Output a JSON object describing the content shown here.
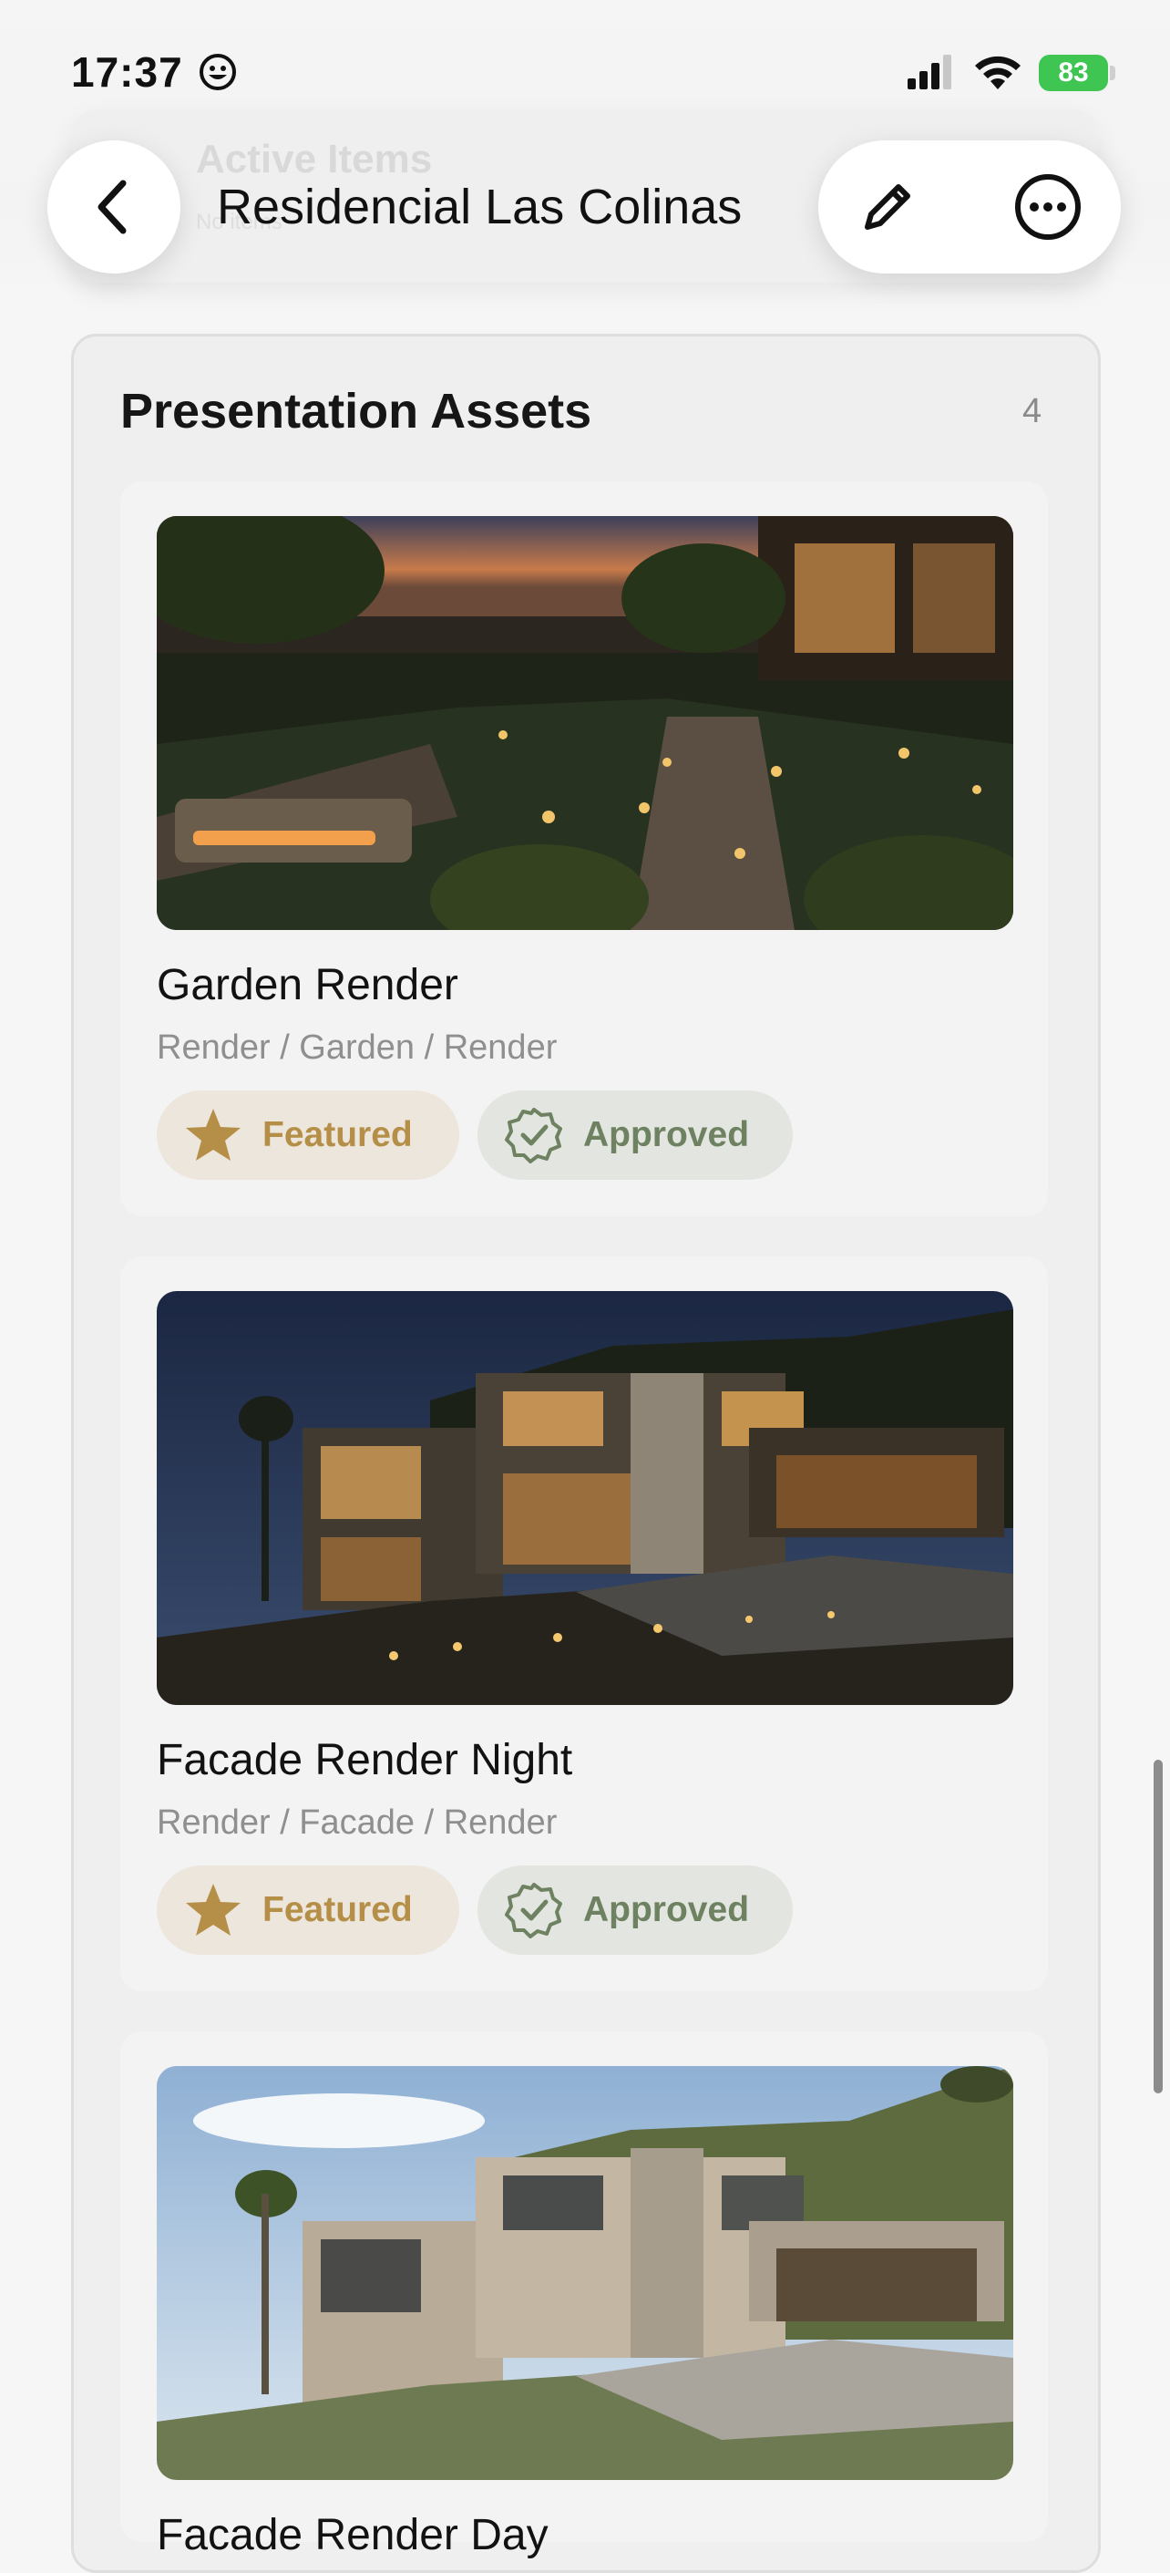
{
  "status_bar": {
    "time": "17:37",
    "battery": "83"
  },
  "background": {
    "ghost_title": "Active Items",
    "ghost_subtitle": "No items"
  },
  "nav": {
    "title": "Residencial Las Colinas"
  },
  "section": {
    "title": "Presentation Assets",
    "count": "4"
  },
  "assets": [
    {
      "name": "Garden Render",
      "path": "Render / Garden / Render",
      "featured": "Featured",
      "approved": "Approved",
      "scene": "garden"
    },
    {
      "name": "Facade Render Night",
      "path": "Render / Facade / Render",
      "featured": "Featured",
      "approved": "Approved",
      "scene": "night"
    },
    {
      "name": "Facade Render Day",
      "path": "",
      "featured": "",
      "approved": "",
      "scene": "day"
    }
  ],
  "colors": {
    "featured_text": "#b58f48",
    "featured_bg": "#ece6dc",
    "approved_text": "#6e8262",
    "approved_bg": "#e3e6e0",
    "battery": "#3ec552"
  },
  "icons": [
    "chevron-left-icon",
    "pencil-icon",
    "more-icon",
    "star-icon",
    "verified-badge-icon",
    "signal-icon",
    "wifi-icon",
    "smiley-icon"
  ]
}
